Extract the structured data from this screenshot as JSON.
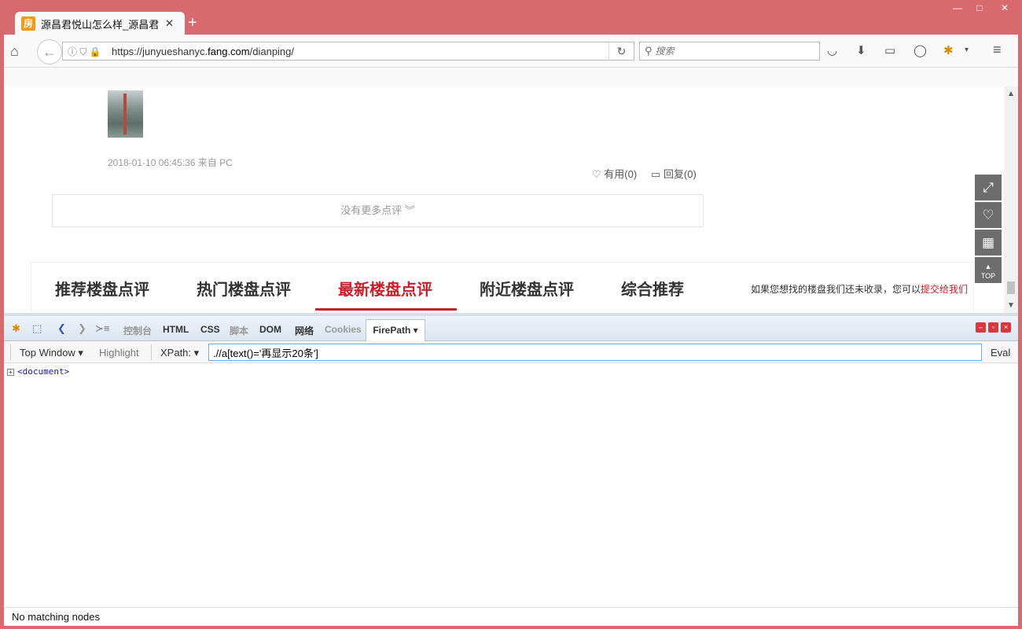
{
  "browser": {
    "tab_title": "源昌君悦山怎么样_源昌君...",
    "tab_favicon": "房",
    "new_tab": "+",
    "window_controls": {
      "minimize": "—",
      "maximize": "□",
      "close": "✕"
    },
    "url_prefix": "https://junyueshanyc.",
    "url_domain": "fang.com",
    "url_path": "/dianping/",
    "url_icons": "ⓘ ⛉ 🔒",
    "search_placeholder": "搜索"
  },
  "page": {
    "comment_meta": "2018-01-10 06:45:36  来自 PC",
    "useful": "♡ 有用(0)",
    "reply": "▭ 回复(0)",
    "no_more": "没有更多点评 ︾",
    "tabs": [
      "推荐楼盘点评",
      "热门楼盘点评",
      "最新楼盘点评",
      "附近楼盘点评",
      "综合推荐"
    ],
    "active_tab": "最新楼盘点评",
    "notice_text": "如果您想找的楼盘我们还未收录，您可以",
    "notice_link": "提交给我们",
    "sidebar": {
      "share": "⤢",
      "fav": "♡",
      "qr": "▦",
      "top": "TOP"
    }
  },
  "firebug": {
    "tabs": [
      "控制台",
      "HTML",
      "CSS",
      "脚本",
      "DOM",
      "网络",
      "Cookies"
    ],
    "active_tab": "FirePath ▾",
    "top_window": "Top Window ▾",
    "highlight": "Highlight",
    "xpath_label": "XPath: ▾",
    "xpath_value": ".//a[text()='再显示20条']",
    "eval": "Eval",
    "tree_root": "<document>",
    "status": "No matching nodes"
  }
}
